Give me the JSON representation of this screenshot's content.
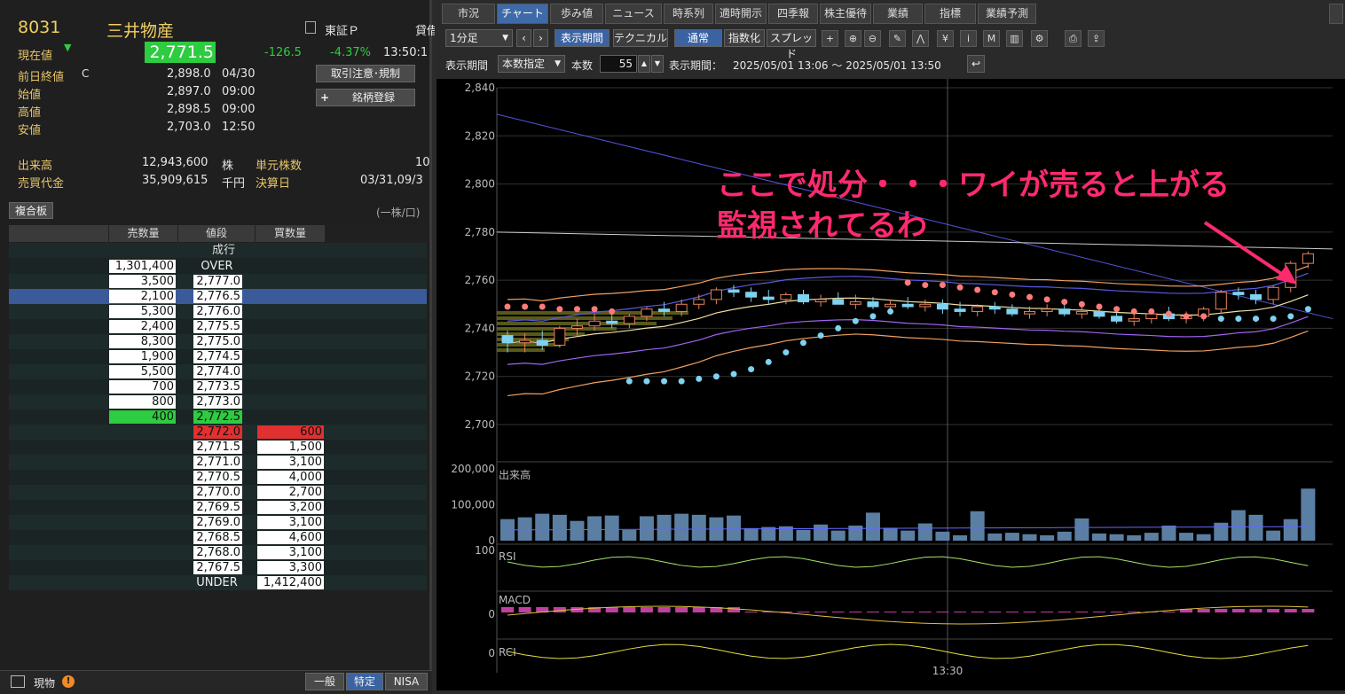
{
  "quote": {
    "code": "8031",
    "name": "三井物産",
    "market_icon": "document-icon",
    "market": "東証Ｐ",
    "lending": "貸借",
    "price_label": "現在値",
    "price_arrow": "▼",
    "price": "2,771.5",
    "change": "-126.5",
    "change_pct": "-4.37%",
    "time": "13:50:1",
    "prev_close_label": "前日終値",
    "prev_close_flag": "C",
    "prev_close": "2,898.0",
    "prev_close_date": "04/30",
    "open_label": "始値",
    "open": "2,897.0",
    "open_time": "09:00",
    "high_label": "高値",
    "high": "2,898.5",
    "high_time": "09:00",
    "low_label": "安値",
    "low": "2,703.0",
    "low_time": "12:50",
    "volume_label": "出来高",
    "volume": "12,943,600",
    "volume_unit": "株",
    "turnover_label": "売買代金",
    "turnover": "35,909,615",
    "turnover_unit": "千円",
    "unit_label": "単元株数",
    "unit": "10",
    "settle_label": "決算日",
    "settle": "03/31,09/3",
    "caution_btn": "取引注意･規制",
    "register_btn": "銘柄登録",
    "register_plus": "+"
  },
  "board": {
    "title": "複合板",
    "unit_note": "(一株/口)",
    "headers": [
      "売数量",
      "値段",
      "買数量"
    ],
    "market_order": "成行",
    "rows": [
      {
        "sell": "1,301,400",
        "price": "OVER",
        "buy": ""
      },
      {
        "sell": "3,500",
        "price": "2,777.0",
        "buy": ""
      },
      {
        "sell": "2,100",
        "price": "2,776.5",
        "buy": ""
      },
      {
        "sell": "5,300",
        "price": "2,776.0",
        "buy": ""
      },
      {
        "sell": "2,400",
        "price": "2,775.5",
        "buy": ""
      },
      {
        "sell": "8,300",
        "price": "2,775.0",
        "buy": ""
      },
      {
        "sell": "1,900",
        "price": "2,774.5",
        "buy": ""
      },
      {
        "sell": "5,500",
        "price": "2,774.0",
        "buy": ""
      },
      {
        "sell": "700",
        "price": "2,773.5",
        "buy": ""
      },
      {
        "sell": "800",
        "price": "2,773.0",
        "buy": ""
      },
      {
        "sell": "400",
        "price": "2,772.5",
        "buy": ""
      },
      {
        "sell": "",
        "price": "2,772.0",
        "buy": "600"
      },
      {
        "sell": "",
        "price": "2,771.5",
        "buy": "1,500"
      },
      {
        "sell": "",
        "price": "2,771.0",
        "buy": "3,100"
      },
      {
        "sell": "",
        "price": "2,770.5",
        "buy": "4,000"
      },
      {
        "sell": "",
        "price": "2,770.0",
        "buy": "2,700"
      },
      {
        "sell": "",
        "price": "2,769.5",
        "buy": "3,200"
      },
      {
        "sell": "",
        "price": "2,769.0",
        "buy": "3,100"
      },
      {
        "sell": "",
        "price": "2,768.5",
        "buy": "4,600"
      },
      {
        "sell": "",
        "price": "2,768.0",
        "buy": "3,100"
      },
      {
        "sell": "",
        "price": "2,767.5",
        "buy": "3,300"
      },
      {
        "sell": "",
        "price": "UNDER",
        "buy": "1,412,400"
      }
    ]
  },
  "footer": {
    "icon": "window-icon",
    "label": "現物",
    "warn_icon": "!",
    "tabs": [
      "一般",
      "特定",
      "NISA"
    ]
  },
  "tabs": [
    "市況",
    "チャート",
    "歩み値",
    "ニュース",
    "時系列",
    "適時開示",
    "四季報",
    "株主優待",
    "業績",
    "指標",
    "業績予測"
  ],
  "toolbar": {
    "interval": "1分足",
    "period_btn": "表示期間",
    "technical_btn": "テクニカル",
    "normal_btn": "通常",
    "index_btn": "指数化",
    "spread_btn": "スプレッド",
    "icons": [
      "crosshair-icon",
      "zoom-in-icon",
      "zoom-out-icon",
      "pencil-icon",
      "chart-line-icon",
      "yen-icon",
      "info-icon",
      "my-icon",
      "bars-icon",
      "wrench-icon",
      "print-icon",
      "export-icon"
    ]
  },
  "period": {
    "label": "表示期間",
    "mode": "本数指定",
    "count_label": "本数",
    "count": "55",
    "range_label": "表示期間：",
    "range": "2025/05/01 13:06 ～ 2025/05/01 13:50"
  },
  "annotation": {
    "line1": "ここで処分・・・ワイが売ると上がる",
    "line2": "監視されてるわ",
    "color": "#ff2a6d"
  },
  "chart_data": {
    "type": "candlestick",
    "ylim": [
      2700,
      2840
    ],
    "yticks": [
      "2,840",
      "2,820",
      "2,800",
      "2,780",
      "2,760",
      "2,740",
      "2,720",
      "2,700"
    ],
    "x_tick": "13:30",
    "ohlc": [
      [
        2737,
        2739,
        2730,
        2734
      ],
      [
        2734,
        2738,
        2730,
        2735
      ],
      [
        2735,
        2739,
        2731,
        2733
      ],
      [
        2733,
        2741,
        2732,
        2740
      ],
      [
        2740,
        2744,
        2737,
        2741
      ],
      [
        2741,
        2746,
        2739,
        2743
      ],
      [
        2743,
        2746,
        2740,
        2742
      ],
      [
        2742,
        2746,
        2740,
        2745
      ],
      [
        2745,
        2749,
        2743,
        2748
      ],
      [
        2748,
        2751,
        2745,
        2747
      ],
      [
        2747,
        2752,
        2745,
        2750
      ],
      [
        2750,
        2754,
        2748,
        2752
      ],
      [
        2752,
        2757,
        2750,
        2756
      ],
      [
        2756,
        2758,
        2753,
        2755
      ],
      [
        2755,
        2757,
        2751,
        2753
      ],
      [
        2753,
        2756,
        2750,
        2752
      ],
      [
        2752,
        2755,
        2750,
        2754
      ],
      [
        2754,
        2756,
        2750,
        2751
      ],
      [
        2751,
        2754,
        2749,
        2752
      ],
      [
        2752,
        2755,
        2750,
        2750
      ],
      [
        2750,
        2754,
        2748,
        2751
      ],
      [
        2751,
        2753,
        2748,
        2749
      ],
      [
        2749,
        2752,
        2747,
        2750
      ],
      [
        2750,
        2753,
        2748,
        2749
      ],
      [
        2749,
        2752,
        2747,
        2750
      ],
      [
        2750,
        2752,
        2746,
        2748
      ],
      [
        2748,
        2751,
        2745,
        2747
      ],
      [
        2747,
        2750,
        2745,
        2749
      ],
      [
        2749,
        2751,
        2746,
        2748
      ],
      [
        2748,
        2750,
        2745,
        2746
      ],
      [
        2746,
        2749,
        2744,
        2747
      ],
      [
        2747,
        2750,
        2745,
        2748
      ],
      [
        2748,
        2751,
        2745,
        2746
      ],
      [
        2746,
        2749,
        2744,
        2747
      ],
      [
        2747,
        2749,
        2744,
        2745
      ],
      [
        2745,
        2748,
        2742,
        2743
      ],
      [
        2743,
        2746,
        2741,
        2744
      ],
      [
        2744,
        2747,
        2742,
        2746
      ],
      [
        2746,
        2749,
        2743,
        2744
      ],
      [
        2744,
        2747,
        2742,
        2745
      ],
      [
        2745,
        2749,
        2743,
        2748
      ],
      [
        2748,
        2756,
        2746,
        2755
      ],
      [
        2755,
        2757,
        2752,
        2754
      ],
      [
        2754,
        2756,
        2750,
        2752
      ],
      [
        2752,
        2758,
        2750,
        2757
      ],
      [
        2757,
        2768,
        2755,
        2767
      ],
      [
        2767,
        2772,
        2765,
        2771
      ]
    ],
    "volume": {
      "ylim": [
        0,
        200000
      ],
      "yticks": [
        "200,000",
        "100,000",
        "0"
      ],
      "label": "出来高",
      "values": [
        60000,
        65000,
        75000,
        72000,
        55000,
        68000,
        70000,
        30000,
        68000,
        72000,
        75000,
        72000,
        65000,
        70000,
        35000,
        38000,
        40000,
        30000,
        45000,
        28000,
        42000,
        78000,
        36000,
        28000,
        48000,
        25000,
        15000,
        82000,
        20000,
        22000,
        18000,
        15000,
        25000,
        62000,
        20000,
        18000,
        15000,
        22000,
        42000,
        22000,
        18000,
        50000,
        85000,
        72000,
        28000,
        60000,
        145000,
        90000
      ]
    },
    "rsi": {
      "label": "RSI",
      "ytick": "100"
    },
    "macd": {
      "label": "MACD",
      "ytick": "0"
    },
    "rci": {
      "label": "RCI",
      "ytick": "0"
    },
    "colors": {
      "up": "#e9845c",
      "down": "#7fd2f0",
      "sar": "#ff7b7b",
      "sar_low": "#7fd2f0",
      "bb": "#f0a060",
      "mid": "#f0e0a0",
      "ma": "#a064f0",
      "vol": "#5b7fa3",
      "macd_hist": "#c040a0"
    }
  }
}
